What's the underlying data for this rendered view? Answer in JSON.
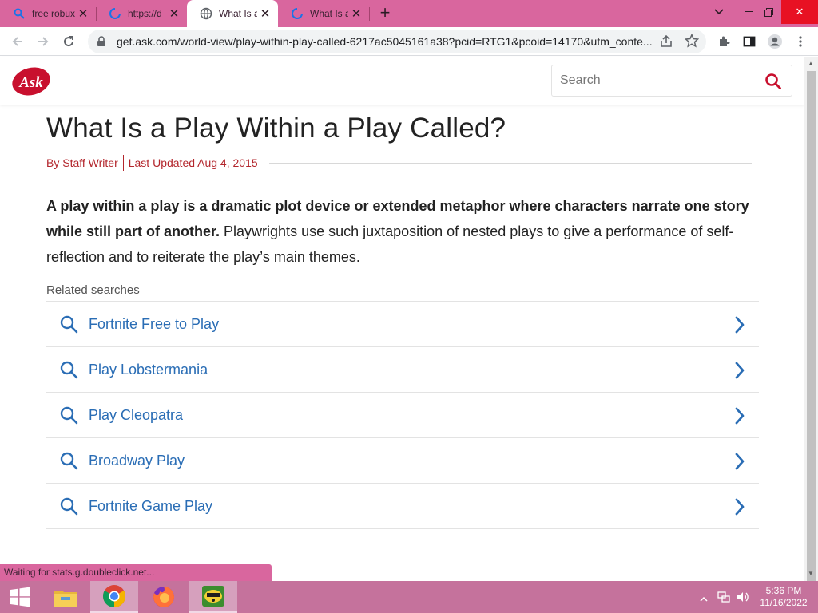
{
  "browser": {
    "tabs": [
      {
        "title": "free robux",
        "icon": "search-icon"
      },
      {
        "title": "https://d",
        "icon": "loading-icon"
      },
      {
        "title": "What Is a",
        "icon": "globe-icon",
        "active": true
      },
      {
        "title": "What Is a",
        "icon": "loading-icon"
      }
    ],
    "url": "get.ask.com/world-view/play-within-play-called-6217ac5045161a38?pcid=RTG1&pcoid=14170&utm_conte...",
    "status_text": "Waiting for stats.g.doubleclick.net..."
  },
  "site": {
    "logo_text": "Ask",
    "search_placeholder": "Search",
    "brand_color": "#c8102e"
  },
  "article": {
    "title": "What Is a Play Within a Play Called?",
    "author": "By Staff Writer",
    "updated": "Last Updated Aug 4, 2015",
    "lead_bold": "A play within a play is a dramatic plot device or extended metaphor where characters narrate one story while still part of another.",
    "lead_rest": " Playwrights use such juxtaposition of nested plays to give a performance of self-reflection and to reiterate the play’s main themes.",
    "related_label": "Related searches",
    "related": [
      "Fortnite Free to Play",
      "Play Lobstermania",
      "Play Cleopatra",
      "Broadway Play",
      "Fortnite Game Play"
    ]
  },
  "taskbar": {
    "time": "5:36 PM",
    "date": "11/16/2022",
    "apps": [
      "file-explorer-icon",
      "chrome-icon",
      "firefox-icon",
      "game-app-icon"
    ]
  }
}
